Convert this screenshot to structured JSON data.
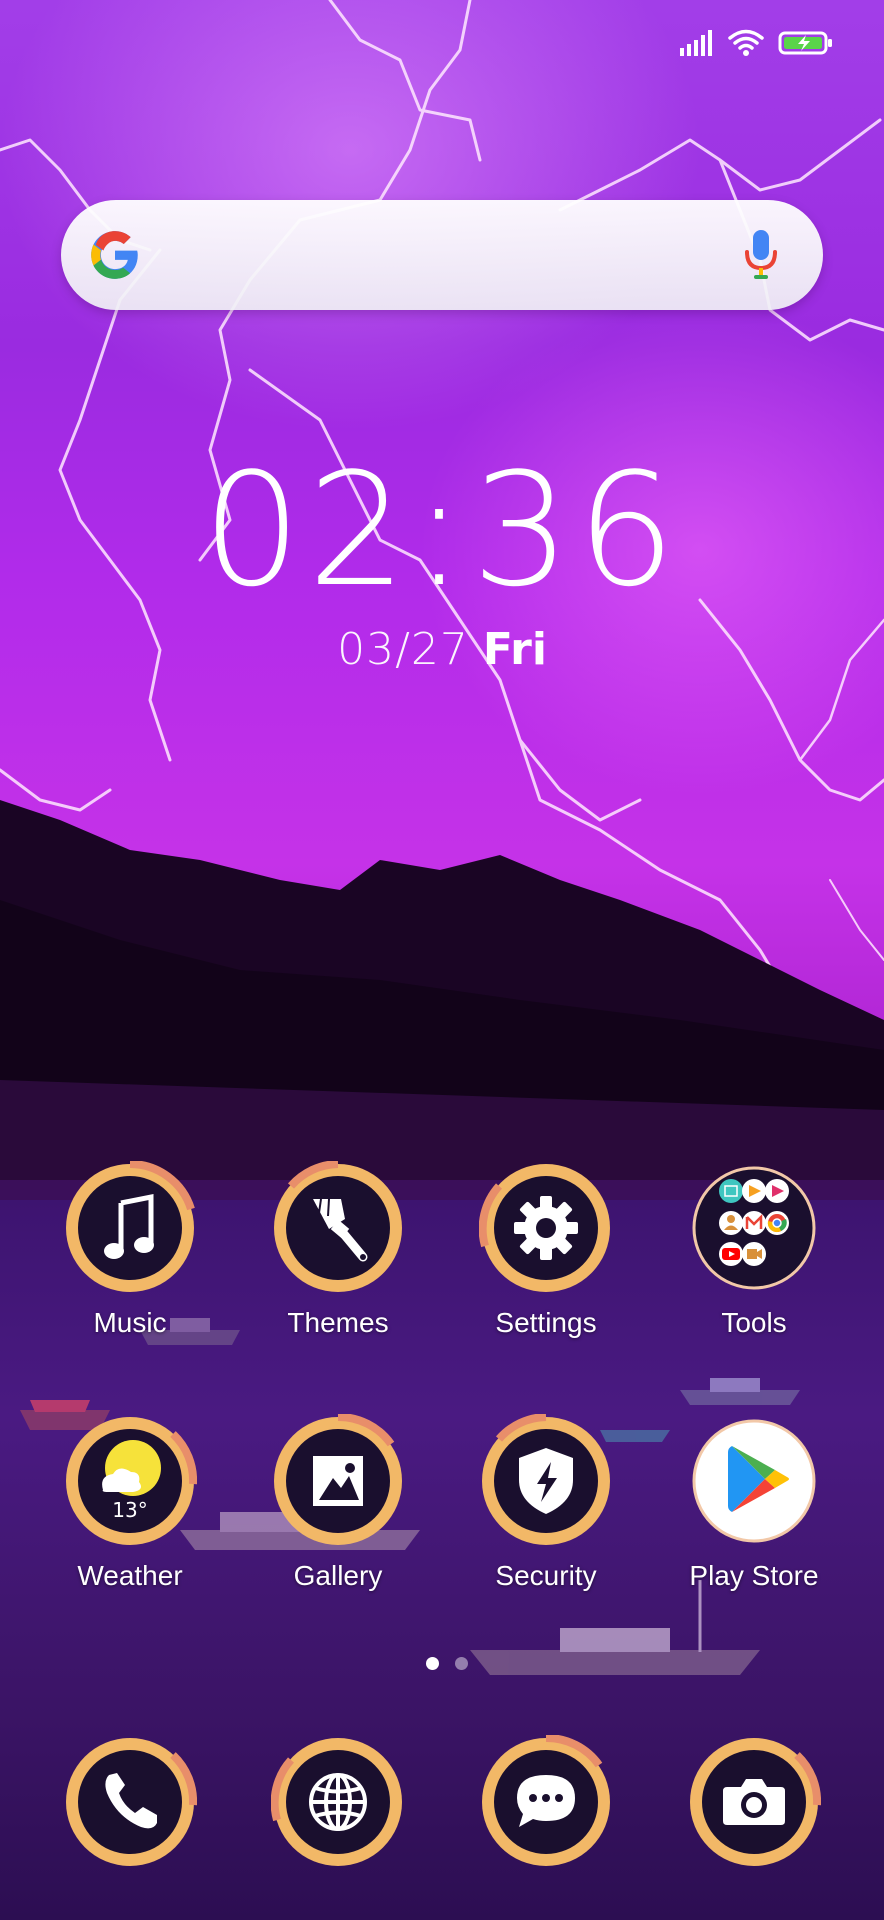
{
  "status": {
    "signal_icon": "signal-bars-icon",
    "wifi_icon": "wifi-icon",
    "battery_icon": "battery-charging-icon"
  },
  "search": {
    "logo_icon": "google-g-icon",
    "mic_icon": "microphone-icon"
  },
  "clock": {
    "time": "02:36",
    "date": "03/27",
    "day": "Fri"
  },
  "apps": [
    {
      "label": "Music",
      "icon": "music-note-icon"
    },
    {
      "label": "Themes",
      "icon": "paintbrush-icon"
    },
    {
      "label": "Settings",
      "icon": "gear-icon"
    },
    {
      "label": "Tools",
      "icon": "folder-icon"
    },
    {
      "label": "Weather",
      "icon": "weather-icon",
      "temp": "13°"
    },
    {
      "label": "Gallery",
      "icon": "image-icon"
    },
    {
      "label": "Security",
      "icon": "shield-bolt-icon"
    },
    {
      "label": "Play Store",
      "icon": "play-store-icon"
    }
  ],
  "dock": [
    {
      "icon": "phone-icon"
    },
    {
      "icon": "globe-icon"
    },
    {
      "icon": "chat-bubble-icon"
    },
    {
      "icon": "camera-icon"
    }
  ],
  "pages": {
    "count": 2,
    "active": 0
  },
  "colors": {
    "ring_outer": "#f4b664",
    "ring_inner": "#1a0f2e",
    "ring_accent": "#e88a6a",
    "search_bg": "#f6f4f8"
  }
}
